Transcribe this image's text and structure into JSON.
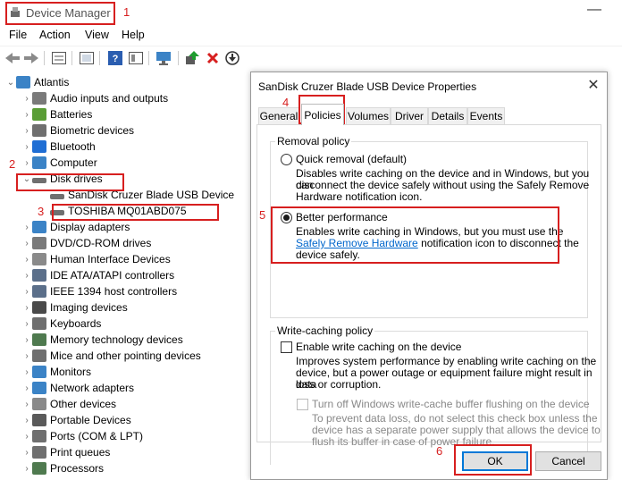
{
  "window": {
    "title": "Device Manager",
    "minimize_icon": "minimize-icon"
  },
  "menu": [
    "File",
    "Action",
    "View",
    "Help"
  ],
  "toolbar_icons": [
    "back-icon",
    "forward-icon",
    "properties-icon",
    "update-icon",
    "help-icon",
    "view-icon",
    "monitor-icon",
    "add-driver-icon",
    "uninstall-icon",
    "download-icon"
  ],
  "tree": {
    "root": "Atlantis",
    "items": [
      {
        "label": "Audio inputs and outputs",
        "icon": "speaker-icon",
        "color": "#7a7a7a"
      },
      {
        "label": "Batteries",
        "icon": "battery-icon",
        "color": "#5a9d36"
      },
      {
        "label": "Biometric devices",
        "icon": "fingerprint-icon",
        "color": "#6f6f6f"
      },
      {
        "label": "Bluetooth",
        "icon": "bluetooth-icon",
        "color": "#1f6ed4"
      },
      {
        "label": "Computer",
        "icon": "computer-icon",
        "color": "#3b83c6"
      },
      {
        "label": "Disk drives",
        "icon": "disk-icon",
        "color": "#6f6f6f"
      },
      {
        "label": "SanDisk Cruzer Blade USB Device",
        "icon": "disk-icon",
        "color": "#6f6f6f"
      },
      {
        "label": "TOSHIBA MQ01ABD075",
        "icon": "disk-icon",
        "color": "#6f6f6f"
      },
      {
        "label": "Display adapters",
        "icon": "display-icon",
        "color": "#3b83c6"
      },
      {
        "label": "DVD/CD-ROM drives",
        "icon": "dvd-icon",
        "color": "#7a7a7a"
      },
      {
        "label": "Human Interface Devices",
        "icon": "hid-icon",
        "color": "#8a8a8a"
      },
      {
        "label": "IDE ATA/ATAPI controllers",
        "icon": "controller-icon",
        "color": "#5b6f8a"
      },
      {
        "label": "IEEE 1394 host controllers",
        "icon": "controller-icon",
        "color": "#5b6f8a"
      },
      {
        "label": "Imaging devices",
        "icon": "camera-icon",
        "color": "#4a4a4a"
      },
      {
        "label": "Keyboards",
        "icon": "keyboard-icon",
        "color": "#6f6f6f"
      },
      {
        "label": "Memory technology devices",
        "icon": "memory-icon",
        "color": "#4f7a4f"
      },
      {
        "label": "Mice and other pointing devices",
        "icon": "mouse-icon",
        "color": "#6f6f6f"
      },
      {
        "label": "Monitors",
        "icon": "monitor-icon",
        "color": "#3b83c6"
      },
      {
        "label": "Network adapters",
        "icon": "network-icon",
        "color": "#3b83c6"
      },
      {
        "label": "Other devices",
        "icon": "other-devices-icon",
        "color": "#8a8a8a"
      },
      {
        "label": "Portable Devices",
        "icon": "portable-icon",
        "color": "#5a5a5a"
      },
      {
        "label": "Ports (COM & LPT)",
        "icon": "port-icon",
        "color": "#6f6f6f"
      },
      {
        "label": "Print queues",
        "icon": "printer-icon",
        "color": "#6f6f6f"
      },
      {
        "label": "Processors",
        "icon": "processor-icon",
        "color": "#4f7a4f"
      }
    ]
  },
  "dialog": {
    "title": "SanDisk Cruzer Blade USB Device Properties",
    "close_icon": "close-icon",
    "tabs": [
      "General",
      "Policies",
      "Volumes",
      "Driver",
      "Details",
      "Events"
    ],
    "active_tab": "Policies",
    "removal_policy": {
      "title": "Removal policy",
      "quick": {
        "label": "Quick removal (default)",
        "desc": [
          "Disables write caching on the device and in Windows, but you can",
          "disconnect the device safely without using the Safely Remove",
          "Hardware notification icon."
        ],
        "selected": false
      },
      "better": {
        "label": "Better performance",
        "desc1": "Enables write caching in Windows, but you must use the",
        "link": "Safely Remove Hardware",
        "desc2": " notification icon to disconnect the",
        "desc3": "device safely.",
        "selected": true
      }
    },
    "write_caching": {
      "title": "Write-caching policy",
      "enable": {
        "label": "Enable write caching on the device",
        "desc": [
          "Improves system performance by enabling write caching on the",
          "device, but a power outage or equipment failure might result in data",
          "loss or corruption."
        ],
        "checked": false
      },
      "turnoff": {
        "label": "Turn off Windows write-cache buffer flushing on the device",
        "desc": [
          "To prevent data loss, do not select this check box unless the",
          "device has a separate power supply that allows the device to",
          "flush its buffer in case of power failure."
        ],
        "checked": false,
        "disabled": true
      }
    },
    "ok_label": "OK",
    "cancel_label": "Cancel"
  },
  "annotations": [
    "1",
    "2",
    "3",
    "4",
    "5",
    "6"
  ],
  "accent_color": "#d71f1f"
}
